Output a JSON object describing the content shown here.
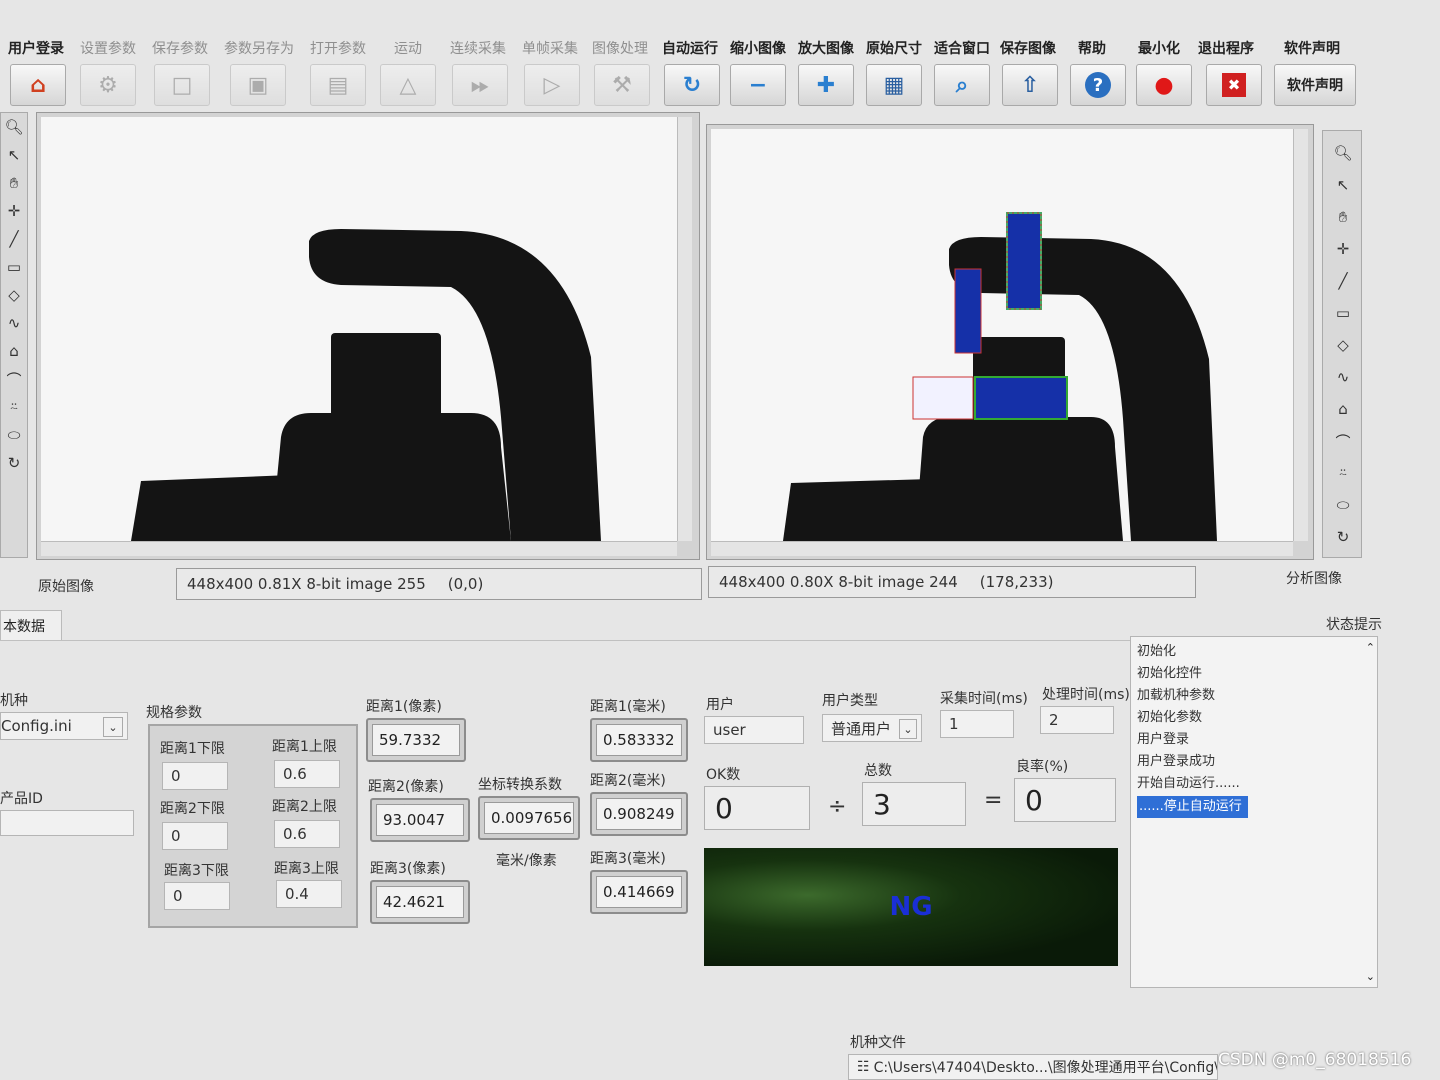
{
  "menu": [
    "用户登录",
    "设置参数",
    "保存参数",
    "参数另存为",
    "打开参数",
    "运动",
    "连续采集",
    "单帧采集",
    "图像处理",
    "自动运行",
    "缩小图像",
    "放大图像",
    "原始尺寸",
    "适合窗口",
    "保存图像",
    "帮助",
    "最小化",
    "退出程序",
    "软件声明"
  ],
  "toolbar": {
    "icons": [
      "home-icon",
      "gear-icon",
      "blank-icon",
      "image-icon",
      "save-icon",
      "triangle-icon",
      "fast-forward-icon",
      "play-icon",
      "tools-icon",
      "refresh-icon",
      "minus-icon",
      "plus-icon",
      "floppy-icon",
      "magnify-icon",
      "export-icon",
      "help-icon",
      "record-icon",
      "close-icon"
    ],
    "declare_label": "软件声明"
  },
  "left_panel": {
    "caption": "原始图像",
    "status_info": "448x400 0.81X 8-bit image 255",
    "status_coord": "(0,0)"
  },
  "right_panel": {
    "caption": "分析图像",
    "status_info": "448x400 0.80X 8-bit image 244",
    "status_coord": "(178,233)"
  },
  "tab_label": "本数据",
  "status_title": "状态提示",
  "model": {
    "label": "机种",
    "value": "Config.ini"
  },
  "product_id": {
    "label": "产品ID",
    "value": ""
  },
  "spec": {
    "title": "规格参数",
    "items": [
      {
        "low_label": "距离1下限",
        "low": "0",
        "high_label": "距离1上限",
        "high": "0.6"
      },
      {
        "low_label": "距离2下限",
        "low": "0",
        "high_label": "距离2上限",
        "high": "0.6"
      },
      {
        "low_label": "距离3下限",
        "low": "0",
        "high_label": "距离3上限",
        "high": "0.4"
      }
    ]
  },
  "pixel_dist": [
    {
      "label": "距离1(像素)",
      "value": "59.7332"
    },
    {
      "label": "距离2(像素)",
      "value": "93.0047"
    },
    {
      "label": "距离3(像素)",
      "value": "42.4621"
    }
  ],
  "coef": {
    "label": "坐标转换系数",
    "value": "0.0097656",
    "unit": "毫米/像素"
  },
  "mm_dist": [
    {
      "label": "距离1(毫米)",
      "value": "0.583332"
    },
    {
      "label": "距离2(毫米)",
      "value": "0.908249"
    },
    {
      "label": "距离3(毫米)",
      "value": "0.414669"
    }
  ],
  "user": {
    "label": "用户",
    "value": "user"
  },
  "user_type": {
    "label": "用户类型",
    "value": "普通用户"
  },
  "capture_time": {
    "label": "采集时间(ms)",
    "value": "1"
  },
  "process_time": {
    "label": "处理时间(ms)",
    "value": "2"
  },
  "ok_count": {
    "label": "OK数",
    "value": "0"
  },
  "total": {
    "label": "总数",
    "value": "3"
  },
  "yield": {
    "label": "良率(%)",
    "value": "0"
  },
  "ops": {
    "divide": "÷",
    "equals": "="
  },
  "result": {
    "text": "NG",
    "color": "#1a2fd6"
  },
  "log": [
    "初始化",
    "初始化控件",
    "加载机种参数",
    "初始化参数",
    "用户登录",
    "用户登录成功",
    "开始自动运行......",
    "......停止自动运行"
  ],
  "config_file": {
    "label": "机种文件",
    "path": "C:\\Users\\47404\\Deskto...\\图像处理通用平台\\Config\\"
  },
  "watermark": "CSDN @m0_68018516"
}
